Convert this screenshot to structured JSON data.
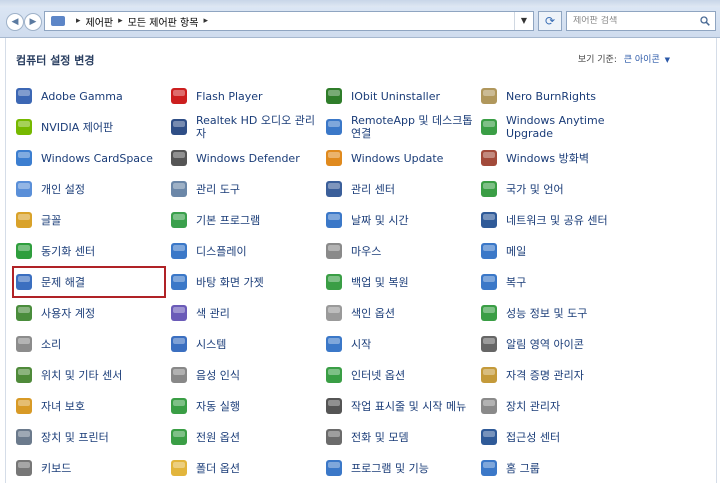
{
  "breadcrumb": [
    "제어판",
    "모든 제어판 항목"
  ],
  "search_placeholder": "제어판 검색",
  "page_title": "컴퓨터 설정 변경",
  "view_by": {
    "label": "보기 기준:",
    "value": "큰 아이콘"
  },
  "items": [
    [
      {
        "label": "Adobe Gamma",
        "icon": "monitor-gamma-icon",
        "color": "#3c67b4"
      },
      {
        "label": "NVIDIA 제어판",
        "icon": "nvidia-icon",
        "color": "#76b900"
      },
      {
        "label": "Windows CardSpace",
        "icon": "cardspace-icon",
        "color": "#3c7ed0"
      },
      {
        "label": "개인 설정",
        "icon": "personalize-icon",
        "color": "#5a8fd8"
      },
      {
        "label": "글꼴",
        "icon": "font-icon",
        "color": "#d9a22a"
      },
      {
        "label": "동기화 센터",
        "icon": "sync-center-icon",
        "color": "#2e9e3d"
      },
      {
        "label": "문제 해결",
        "icon": "troubleshoot-icon",
        "color": "#3b6fc0",
        "selected": true
      },
      {
        "label": "사용자 계정",
        "icon": "user-accounts-icon",
        "color": "#4a8d3c"
      },
      {
        "label": "소리",
        "icon": "speaker-icon",
        "color": "#8c8c8c"
      },
      {
        "label": "위치 및 기타 센서",
        "icon": "sensor-icon",
        "color": "#4f8a3a"
      },
      {
        "label": "자녀 보호",
        "icon": "parental-icon",
        "color": "#d89a26"
      },
      {
        "label": "장치 및 프린터",
        "icon": "printer-icon",
        "color": "#6b7a8c"
      },
      {
        "label": "키보드",
        "icon": "keyboard-icon",
        "color": "#777777"
      }
    ],
    [
      {
        "label": "Flash Player",
        "icon": "flash-icon",
        "color": "#cc1f1f"
      },
      {
        "label": "Realtek HD 오디오 관리자",
        "icon": "realtek-icon",
        "color": "#2f4e86"
      },
      {
        "label": "Windows Defender",
        "icon": "defender-icon",
        "color": "#555555"
      },
      {
        "label": "관리 도구",
        "icon": "admin-tools-icon",
        "color": "#6b87a8"
      },
      {
        "label": "기본 프로그램",
        "icon": "default-programs-icon",
        "color": "#3aa04c"
      },
      {
        "label": "디스플레이",
        "icon": "display-icon",
        "color": "#3b78c8"
      },
      {
        "label": "바탕 화면 가젯",
        "icon": "gadgets-icon",
        "color": "#3b78c8"
      },
      {
        "label": "색 관리",
        "icon": "color-mgmt-icon",
        "color": "#6b5bb8"
      },
      {
        "label": "시스템",
        "icon": "system-icon",
        "color": "#3b6fc0"
      },
      {
        "label": "음성 인식",
        "icon": "microphone-icon",
        "color": "#888888"
      },
      {
        "label": "자동 실행",
        "icon": "autoplay-icon",
        "color": "#3a9e45"
      },
      {
        "label": "전원 옵션",
        "icon": "power-icon",
        "color": "#3a9e45"
      },
      {
        "label": "폴더 옵션",
        "icon": "folder-icon",
        "color": "#e2b53c"
      }
    ],
    [
      {
        "label": "IObit Uninstaller",
        "icon": "iobit-icon",
        "color": "#2f7d2a"
      },
      {
        "label": "RemoteApp 및 데스크톱 연결",
        "icon": "remoteapp-icon",
        "color": "#3b78c8"
      },
      {
        "label": "Windows Update",
        "icon": "windows-update-icon",
        "color": "#e08a1e"
      },
      {
        "label": "관리 센터",
        "icon": "action-center-icon",
        "color": "#3b5f9a"
      },
      {
        "label": "날짜 및 시간",
        "icon": "clock-icon",
        "color": "#3b78c8"
      },
      {
        "label": "마우스",
        "icon": "mouse-icon",
        "color": "#8a8a8a"
      },
      {
        "label": "백업 및 복원",
        "icon": "backup-icon",
        "color": "#3a9e45"
      },
      {
        "label": "색인 옵션",
        "icon": "indexing-icon",
        "color": "#9a9a9a"
      },
      {
        "label": "시작",
        "icon": "getting-started-icon",
        "color": "#3b78c8"
      },
      {
        "label": "인터넷 옵션",
        "icon": "internet-options-icon",
        "color": "#3a9e45"
      },
      {
        "label": "작업 표시줄 및 시작 메뉴",
        "icon": "taskbar-icon",
        "color": "#555555"
      },
      {
        "label": "전화 및 모뎀",
        "icon": "phone-icon",
        "color": "#6b6b6b"
      },
      {
        "label": "프로그램 및 기능",
        "icon": "programs-icon",
        "color": "#3b78c8"
      }
    ],
    [
      {
        "label": "Nero BurnRights",
        "icon": "nero-icon",
        "color": "#b0975c"
      },
      {
        "label": "Windows Anytime Upgrade",
        "icon": "anytime-upgrade-icon",
        "color": "#3a9e45"
      },
      {
        "label": "Windows 방화벽",
        "icon": "firewall-icon",
        "color": "#a24a3a"
      },
      {
        "label": "국가 및 언어",
        "icon": "globe-icon",
        "color": "#3a9e45"
      },
      {
        "label": "네트워크 및 공유 센터",
        "icon": "network-icon",
        "color": "#2f5a98"
      },
      {
        "label": "메일",
        "icon": "mail-icon",
        "color": "#3b78c8"
      },
      {
        "label": "복구",
        "icon": "recovery-icon",
        "color": "#3b78c8"
      },
      {
        "label": "성능 정보 및 도구",
        "icon": "performance-icon",
        "color": "#3a9e45"
      },
      {
        "label": "알림 영역 아이콘",
        "icon": "notification-icon",
        "color": "#666666"
      },
      {
        "label": "자격 증명 관리자",
        "icon": "credential-icon",
        "color": "#c49a3a"
      },
      {
        "label": "장치 관리자",
        "icon": "device-manager-icon",
        "color": "#8a8a8a"
      },
      {
        "label": "접근성 센터",
        "icon": "ease-access-icon",
        "color": "#2f5a98"
      },
      {
        "label": "홈 그룹",
        "icon": "homegroup-icon",
        "color": "#3b78c8"
      }
    ]
  ]
}
